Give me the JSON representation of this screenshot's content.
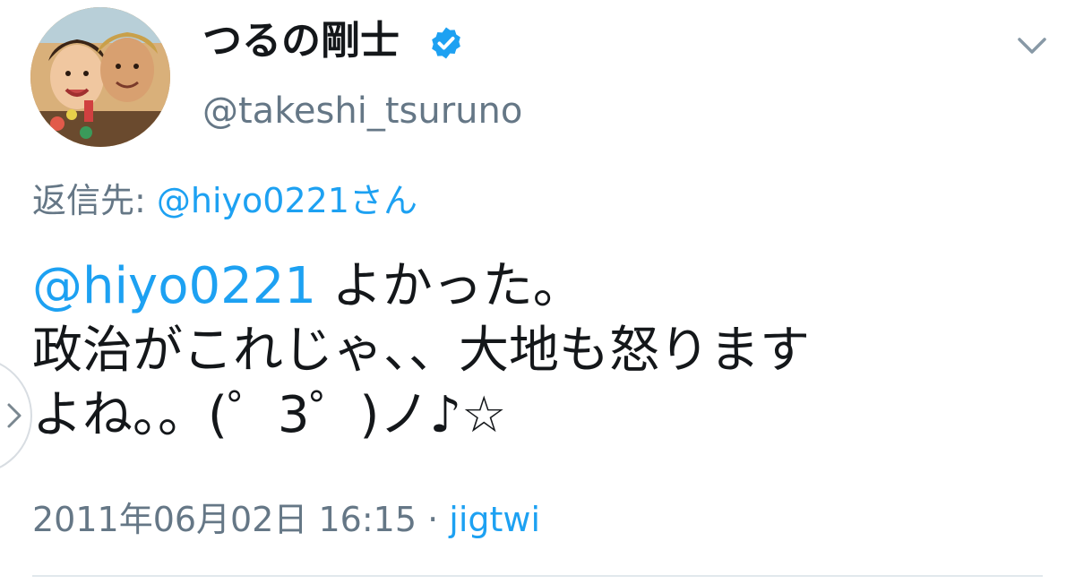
{
  "user": {
    "display_name": "つるの剛士",
    "handle": "@takeshi_tsuruno",
    "verified": true,
    "avatar_icon": "profile-photo"
  },
  "reply_to": {
    "label": "返信先: ",
    "target": "@hiyo0221さん"
  },
  "tweet": {
    "mention": "@hiyo0221",
    "line1": " よかった。",
    "line2": "政治がこれじゃ、、大地も怒ります",
    "line3": "よね。。(゜3゜)ノ♪☆"
  },
  "meta": {
    "timestamp": "2011年06月02日 16:15",
    "separator": " · ",
    "source": "jigtwi"
  },
  "colors": {
    "link": "#1da1f2",
    "text": "#14171a",
    "secondary": "#657786",
    "verified": "#1da1f2"
  },
  "icons": {
    "menu": "chevron-down-icon",
    "verified": "verified-badge-icon",
    "side": "chevron-right-icon"
  }
}
